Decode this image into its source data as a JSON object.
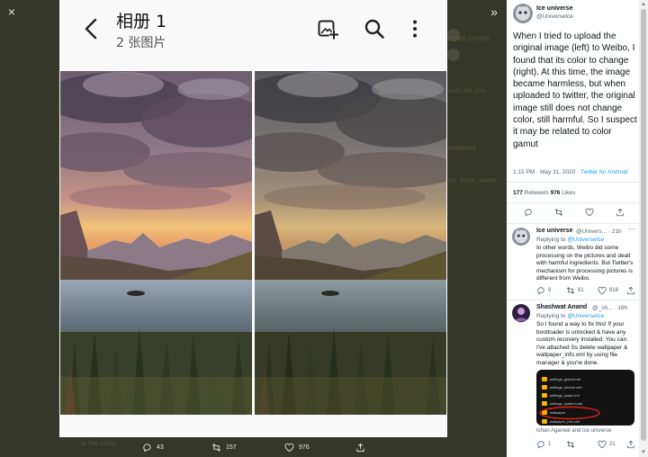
{
  "viewer": {
    "close_icon": "×",
    "collapse_icon": "»"
  },
  "background_page": {
    "ghost_texts": [
      "ireast people",
      "ouly for you",
      "establed",
      "mr_from_tweet",
      "is the story"
    ]
  },
  "phone": {
    "album_title": "相册 1",
    "album_subtitle": "2 张图片",
    "icons": [
      "back-arrow-icon",
      "add-photo-icon",
      "search-icon",
      "more-vertical-icon"
    ]
  },
  "image_actions": {
    "replies": "43",
    "retweets": "157",
    "likes": "976"
  },
  "tweet": {
    "author_name": "Ice universe",
    "author_handle": "@UniverseIce",
    "text": "When I tried to upload the original image (left) to Weibo, I found that its color to change (right). At this time, the image became harmless, but when uploaded to twitter, the original image still does not change color, still harmful. So I suspect it may be related to color gamut",
    "time": "1:15 PM · May 31, 2020 · ",
    "source": "Twitter for Android",
    "retweets_count": "177",
    "retweets_label": " Retweets   ",
    "likes_count": "976",
    "likes_label": " Likes"
  },
  "replies": [
    {
      "name": "Ice universe",
      "handle": "@Univers... · 21h",
      "replying_prefix": "Replying to ",
      "replying_to": "@UniverseIce",
      "text": "In other words, Weibo did some processing on the pictures and dealt with harmful ingredients. But Twitter's mechanism for processing pictures is different from Weibo.",
      "reply_count": "9",
      "retweet_count": "61",
      "like_count": "818"
    },
    {
      "name": "Shashwat Anand",
      "handle": "@_sh... · 18h",
      "replying_prefix": "Replying to ",
      "replying_to": "@UniverseIce",
      "text": "So I found a way to fix this! If your bootloader is unlocked & have any custom recovery installed. You can. I've attached Ss delete wallpaper & wallpaper_info.xml  by using file manager & you're done.",
      "files": [
        "settings_global.xml",
        "settings_secure.xml",
        "settings_ssaid.xml",
        "settings_system.xml",
        "wallpaper",
        "wallpaper_info.xml"
      ],
      "tagged": "Ishan Agarwal and Ice universe",
      "reply_count": "1",
      "like_count": "21"
    }
  ]
}
